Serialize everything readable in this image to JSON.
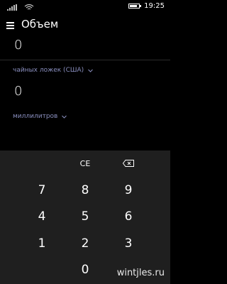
{
  "status_bar": {
    "time": "19:25",
    "battery_level": 0.8
  },
  "header": {
    "title": "Объем"
  },
  "converter": {
    "input_value": "0",
    "input_unit": "чайных ложек (США)",
    "output_value": "0",
    "output_unit": "миллилитров"
  },
  "keypad": {
    "ce_label": "CE",
    "keys": [
      "7",
      "8",
      "9",
      "4",
      "5",
      "6",
      "1",
      "2",
      "3",
      "0"
    ]
  },
  "watermark": {
    "text": "wintjles.ru"
  },
  "icons": [
    "hamburger-icon",
    "signal-icon",
    "wifi-icon",
    "battery-icon",
    "chevron-down-icon",
    "backspace-icon"
  ],
  "colors": {
    "background": "#000000",
    "keypad_background": "#1f1f1f",
    "unit_text": "#8a8fbf"
  }
}
